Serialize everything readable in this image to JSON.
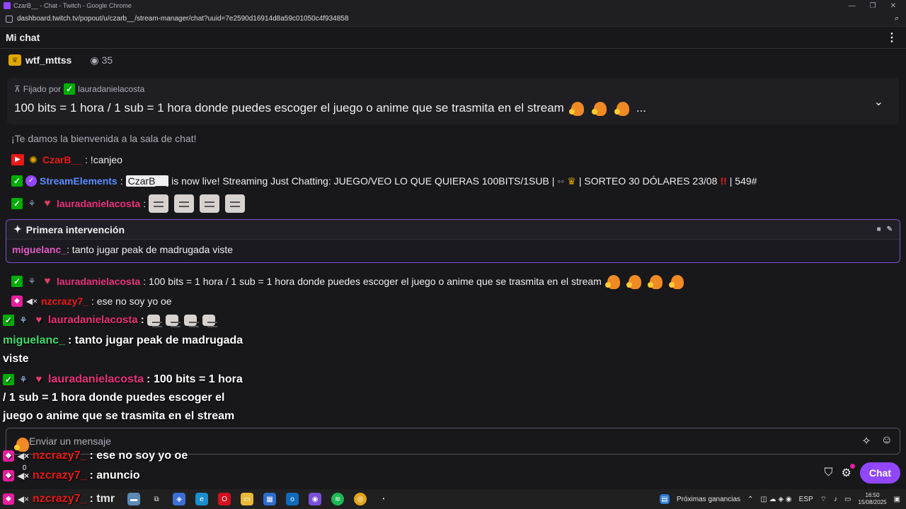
{
  "window": {
    "title": "CzarB__ - Chat - Twitch - Google Chrome",
    "url": "dashboard.twitch.tv/popout/u/czarb__/stream-manager/chat?uuid=7e2590d16914d8a59c01050c4f934858"
  },
  "header": {
    "title": "Mi chat"
  },
  "top_user": {
    "name": "wtf_mttss",
    "viewers": "35"
  },
  "pinned": {
    "prefix": "Fijado por",
    "by": "lauradanielacosta",
    "message": "100 bits = 1 hora / 1 sub = 1 hora donde puedes escoger el juego o anime que se trasmita en el stream",
    "ellipsis": "..."
  },
  "chat": {
    "welcome": "¡Te damos la bienvenida a la sala de chat!",
    "messages": [
      {
        "user": "CzarB__",
        "text": ": !canjeo"
      },
      {
        "user": "StreamElements",
        "sep": ":",
        "mention": "CzarB__",
        "text": "is now live! Streaming Just Chatting: JUEGO/VEO LO QUE QUIERAS 100BITS/1SUB |",
        "text2": "| SORTEO 30 DÓLARES 23/08",
        "alert": "!!",
        "text3": "| 549#"
      },
      {
        "user": "lauradanielacosta",
        "text": ":"
      },
      {
        "user": "lauradanielacosta",
        "text": ": 100 bits = 1 hora / 1 sub = 1 hora donde puedes escoger el juego o anime que se trasmita en el stream"
      },
      {
        "user": "nzcrazy7_",
        "text": ": ese no soy yo oe"
      }
    ],
    "first_box": {
      "title": "Primera intervención",
      "user": "miguelanc_",
      "text": ": tanto jugar peak de madrugada viste"
    }
  },
  "overlay": {
    "l1_user": "lauradanielacosta",
    "l1_text": ":",
    "l2_user": "miguelanc_",
    "l2_text": ": tanto jugar peak de madrugada",
    "l3_text": "viste",
    "l4_user": "lauradanielacosta",
    "l4_text": ": 100 bits = 1 hora",
    "l5_text": "/ 1 sub = 1 hora donde puedes escoger el",
    "l6_text": "juego o anime que se trasmita en el stream",
    "l7_user": "nzcrazy7_",
    "l7_text": ": ese no soy yo oe",
    "l8_user": "nzcrazy7_",
    "l8_text": ": anuncio",
    "l9_user": "nzcrazy7_",
    "l9_text": ": tmr",
    "l_small": "0"
  },
  "input": {
    "placeholder": "Enviar un mensaje"
  },
  "chat_button": "Chat",
  "taskbar": {
    "news": "Próximas ganancias",
    "lang": "ESP",
    "time": "16:50",
    "date": "15/08/2025"
  },
  "colors": {
    "accent": "#9147ff",
    "bg": "#18181b"
  }
}
